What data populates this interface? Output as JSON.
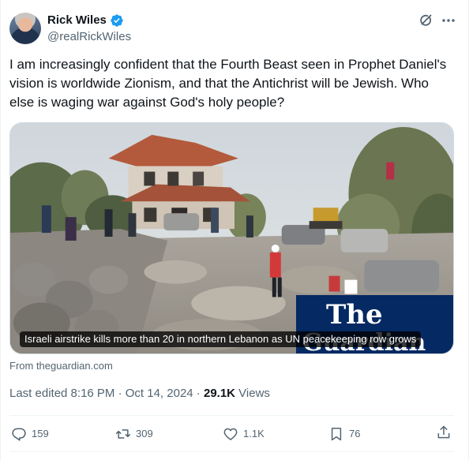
{
  "author": {
    "display_name": "Rick Wiles",
    "handle": "@realRickWiles",
    "verified": true
  },
  "tweet": {
    "text": "I am increasingly confident that the Fourth Beast seen in  Prophet Daniel's vision is worldwide Zionism, and that the Antichrist will be Jewish. Who else is waging war against God's holy people?"
  },
  "media": {
    "caption": "Israeli airstrike kills more than 20 in northern Lebanon as UN peacekeeping row grows",
    "brand_line1": "The",
    "brand_line2": "Guardian",
    "brand_color": "#052962",
    "source": "From theguardian.com"
  },
  "meta": {
    "edited": "Last edited 8:16 PM · Oct 14, 2024 · ",
    "views_count": "29.1K",
    "views_label": " Views"
  },
  "actions": {
    "replies": "159",
    "reposts": "309",
    "likes": "1.1K",
    "bookmarks": "76"
  },
  "icons": {
    "verified": "verified-badge-icon",
    "grok": "grok-icon",
    "more": "more-icon",
    "reply": "reply-icon",
    "repost": "repost-icon",
    "like": "heart-icon",
    "bookmark": "bookmark-icon",
    "share": "share-icon"
  },
  "colors": {
    "accent": "#1d9bf0",
    "secondary_text": "#536471",
    "primary_text": "#0f1419"
  }
}
